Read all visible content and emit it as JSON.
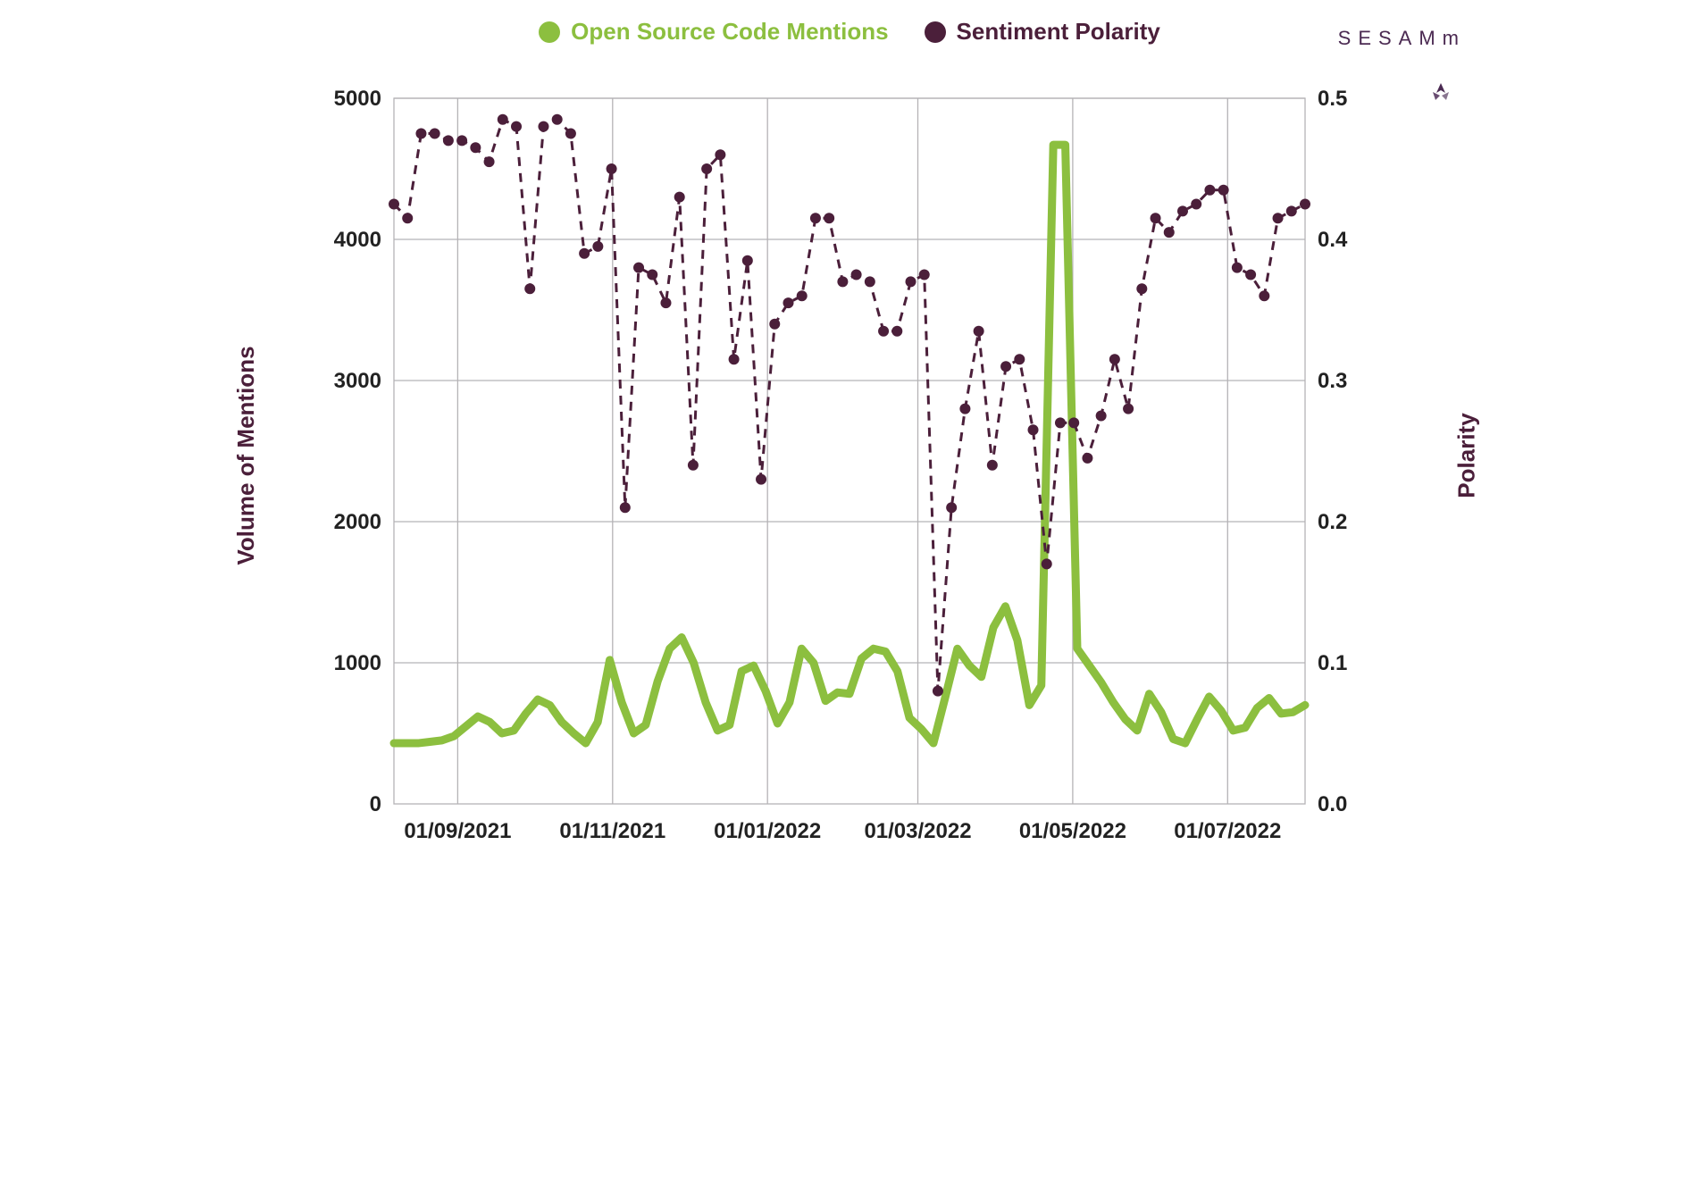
{
  "legend": {
    "mentions_label": "Open Source Code Mentions",
    "polarity_label": "Sentiment Polarity"
  },
  "brand_text": "SESAMm",
  "axes": {
    "y_left_label": "Volume of Mentions",
    "y_right_label": "Polarity",
    "y_left_ticks": [
      "0",
      "1000",
      "2000",
      "3000",
      "4000",
      "5000"
    ],
    "y_right_ticks": [
      "0.0",
      "0.1",
      "0.2",
      "0.3",
      "0.4",
      "0.5"
    ],
    "x_ticks": [
      "01/09/2021",
      "01/11/2021",
      "01/01/2022",
      "01/03/2022",
      "01/05/2022",
      "01/07/2022"
    ]
  },
  "colors": {
    "mentions": "#8cbf3f",
    "polarity": "#4b1f3a",
    "grid": "#b5b3b6"
  },
  "chart_data": {
    "type": "line",
    "x_start": "01/08/2021",
    "x_end": "01/08/2022",
    "xlabel": "",
    "title": "",
    "y_left": {
      "label": "Volume of Mentions",
      "range": [
        0,
        5000
      ]
    },
    "y_right": {
      "label": "Polarity",
      "range": [
        0.0,
        0.5
      ]
    },
    "series": [
      {
        "name": "Open Source Code Mentions",
        "axis": "left",
        "style": "solid",
        "values": [
          430,
          430,
          430,
          440,
          450,
          480,
          550,
          620,
          580,
          500,
          520,
          640,
          740,
          700,
          580,
          500,
          430,
          580,
          1020,
          720,
          500,
          560,
          870,
          1100,
          1180,
          1000,
          720,
          520,
          560,
          940,
          980,
          800,
          570,
          720,
          1100,
          1000,
          730,
          790,
          780,
          1030,
          1100,
          1080,
          940,
          610,
          530,
          430,
          760,
          1100,
          980,
          900,
          1250,
          1400,
          1160,
          700,
          840,
          4670,
          4670,
          1100,
          980,
          860,
          720,
          600,
          520,
          780,
          650,
          460,
          430,
          600,
          760,
          660,
          520,
          540,
          680,
          750,
          640,
          650,
          700
        ]
      },
      {
        "name": "Sentiment Polarity",
        "axis": "right",
        "style": "dashed-markers",
        "values": [
          0.425,
          0.415,
          0.475,
          0.475,
          0.47,
          0.47,
          0.465,
          0.455,
          0.485,
          0.48,
          0.365,
          0.48,
          0.485,
          0.475,
          0.39,
          0.395,
          0.45,
          0.21,
          0.38,
          0.375,
          0.355,
          0.43,
          0.24,
          0.45,
          0.46,
          0.315,
          0.385,
          0.23,
          0.34,
          0.355,
          0.36,
          0.415,
          0.415,
          0.37,
          0.375,
          0.37,
          0.335,
          0.335,
          0.37,
          0.375,
          0.08,
          0.21,
          0.28,
          0.335,
          0.24,
          0.31,
          0.315,
          0.265,
          0.17,
          0.27,
          0.27,
          0.245,
          0.275,
          0.315,
          0.28,
          0.365,
          0.415,
          0.405,
          0.42,
          0.425,
          0.435,
          0.435,
          0.38,
          0.375,
          0.36,
          0.415,
          0.42,
          0.425
        ]
      }
    ]
  }
}
